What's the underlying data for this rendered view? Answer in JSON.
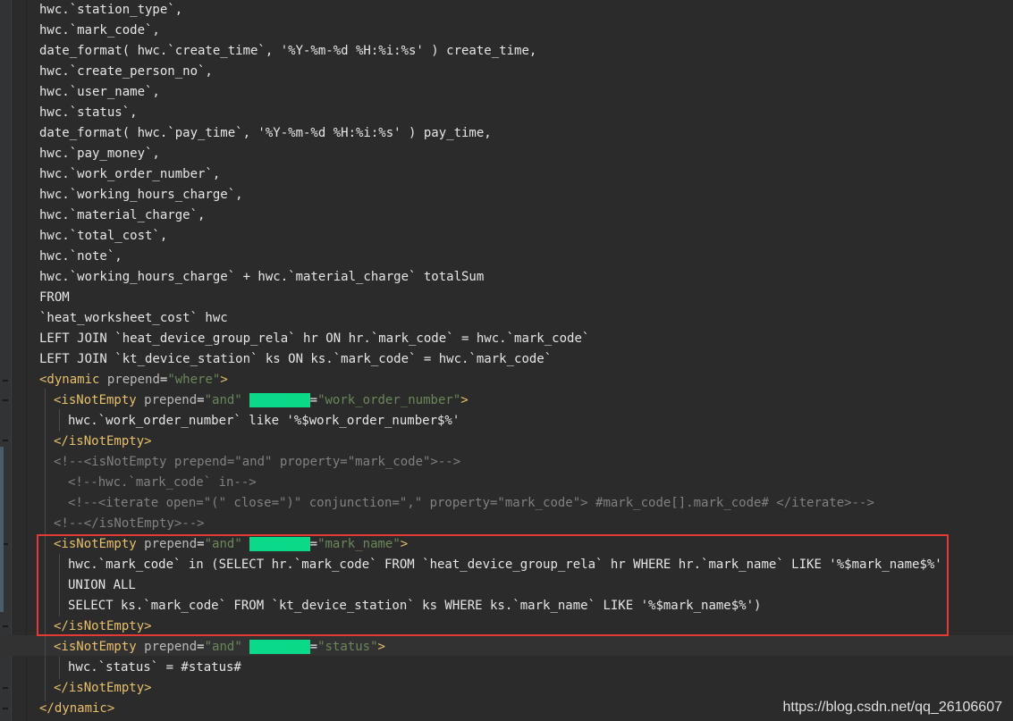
{
  "code_lines": [
    "hwc.`station_type`,",
    "hwc.`mark_code`,",
    "date_format( hwc.`create_time`, '%Y-%m-%d %H:%i:%s' ) create_time,",
    "hwc.`create_person_no`,",
    "hwc.`user_name`,",
    "hwc.`status`,",
    "date_format( hwc.`pay_time`, '%Y-%m-%d %H:%i:%s' ) pay_time,",
    "hwc.`pay_money`,",
    "hwc.`work_order_number`,",
    "hwc.`working_hours_charge`,",
    "hwc.`material_charge`,",
    "hwc.`total_cost`,",
    "hwc.`note`,",
    "hwc.`working_hours_charge` + hwc.`material_charge` totalSum",
    "FROM",
    "`heat_worksheet_cost` hwc",
    "LEFT JOIN `heat_device_group_rela` hr ON hr.`mark_code` = hwc.`mark_code`",
    "LEFT JOIN `kt_device_station` ks ON ks.`mark_code` = hwc.`mark_code`"
  ],
  "xml": {
    "dynamic_open_tag": "dynamic",
    "prepend_attr": "prepend",
    "where_val": "\"where\"",
    "isNotEmpty": "isNotEmpty",
    "and_val": "\"and\"",
    "property_attr": "property",
    "work_order_val": "\"work_order_number\"",
    "work_order_body": "hwc.`work_order_number` like '%$work_order_number$%'",
    "comment1": "<!--<isNotEmpty prepend=\"and\" property=\"mark_code\">-->",
    "comment2": "<!--hwc.`mark_code` in-->",
    "comment3": "<!--<iterate open=\"(\" close=\")\" conjunction=\",\" property=\"mark_code\"> #mark_code[].mark_code# </iterate>-->",
    "comment4": "<!--</isNotEmpty>-->",
    "mark_name_val": "\"mark_name\"",
    "mark_name_body1": "hwc.`mark_code` in (SELECT hr.`mark_code` FROM `heat_device_group_rela` hr WHERE hr.`mark_name` LIKE '%$mark_name$%'",
    "mark_name_body2": "UNION ALL",
    "mark_name_body3": "SELECT ks.`mark_code` FROM `kt_device_station` ks WHERE ks.`mark_name` LIKE '%$mark_name$%')",
    "status_val": "\"status\"",
    "status_body": "hwc.`status` = #status#"
  },
  "watermark": "https://blog.csdn.net/qq_26106607",
  "colors": {
    "highlight_box": "#e53935",
    "property_highlight": "#0bd989"
  }
}
